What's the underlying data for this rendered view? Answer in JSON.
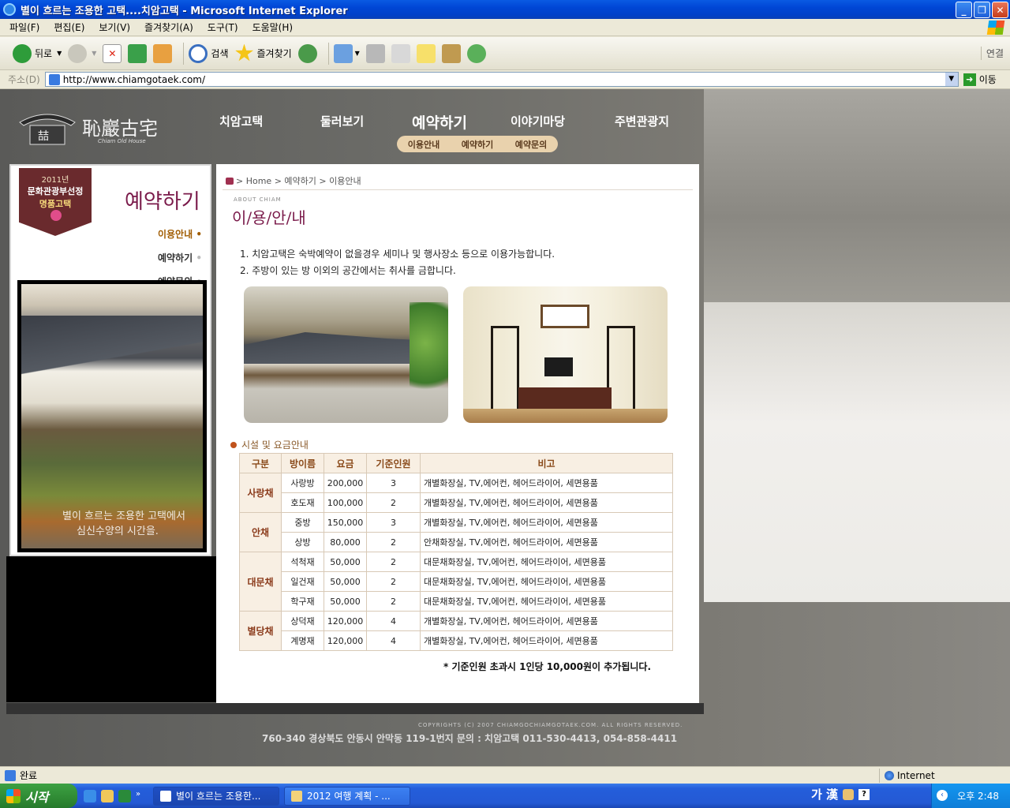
{
  "window": {
    "title": "별이 흐르는 조용한 고택....치암고택 - Microsoft Internet Explorer"
  },
  "menu": [
    "파일(F)",
    "편집(E)",
    "보기(V)",
    "즐겨찾기(A)",
    "도구(T)",
    "도움말(H)"
  ],
  "toolbar": {
    "back": "뒤로",
    "search": "검색",
    "favorites": "즐겨찾기",
    "links": "연결"
  },
  "address": {
    "label": "주소(D)",
    "url": "http://www.chiamgotaek.com/",
    "go": "이동"
  },
  "site": {
    "logo_text": "恥巖古宅",
    "logo_sub": "Chiam Old House",
    "nav": [
      "치암고택",
      "둘러보기",
      "예약하기",
      "이야기마당",
      "주변관광지"
    ],
    "subnav": [
      "이용안내",
      "예약하기",
      "예약문의"
    ],
    "badge": {
      "year": "2011년",
      "line1": "문화관광부선정",
      "line2": "명품고택"
    },
    "left_title": "예약하기",
    "left_menu": [
      "이용안내",
      "예약하기",
      "예약문의"
    ],
    "photo_caption": [
      "별이 흐르는 조용한 고택에서",
      "심신수양의 시간을."
    ],
    "breadcrumb": {
      "home": "Home",
      "section": "예약하기",
      "page": "이용안내"
    },
    "about": "ABOUT CHIAM",
    "page_title": "이/용/안/내",
    "notes": [
      "1. 치암고택은 숙박예약이 없을경우 세미나 및 행사장소 등으로 이용가능합니다.",
      "2. 주방이 있는 방 이외의 공간에서는 취사를 금합니다."
    ],
    "section_title": "시설 및 요금안내",
    "table": {
      "headers": [
        "구분",
        "방이름",
        "요금",
        "기준인원",
        "비고"
      ],
      "groups": [
        {
          "name": "사랑채",
          "rows": [
            {
              "room": "사랑방",
              "fee": "200,000",
              "people": "3",
              "note": "개별화장실, TV,에어컨, 헤어드라이어, 세면용품"
            },
            {
              "room": "호도재",
              "fee": "100,000",
              "people": "2",
              "note": "개별화장실, TV,에어컨, 헤어드라이어, 세면용품"
            }
          ]
        },
        {
          "name": "안채",
          "rows": [
            {
              "room": "중방",
              "fee": "150,000",
              "people": "3",
              "note": "개별화장실, TV,에어컨, 헤어드라이어, 세면용품"
            },
            {
              "room": "상방",
              "fee": "80,000",
              "people": "2",
              "note": "안채화장실, TV,에어컨, 헤어드라이어, 세면용품"
            }
          ]
        },
        {
          "name": "대문채",
          "rows": [
            {
              "room": "석척재",
              "fee": "50,000",
              "people": "2",
              "note": "대문채화장실, TV,에어컨, 헤어드라이어, 세면용품"
            },
            {
              "room": "일건재",
              "fee": "50,000",
              "people": "2",
              "note": "대문채화장실, TV,에어컨, 헤어드라이어, 세면용품"
            },
            {
              "room": "학구재",
              "fee": "50,000",
              "people": "2",
              "note": "대문채화장실, TV,에어컨, 헤어드라이어, 세면용품"
            }
          ]
        },
        {
          "name": "별당채",
          "rows": [
            {
              "room": "상덕재",
              "fee": "120,000",
              "people": "4",
              "note": "개별화장실, TV,에어컨, 헤어드라이어, 세면용품"
            },
            {
              "room": "계명재",
              "fee": "120,000",
              "people": "4",
              "note": "개별화장실, TV,에어컨, 헤어드라이어, 세면용품"
            }
          ]
        }
      ]
    },
    "surcharge": "* 기준인원 초과시 1인당 10,000원이 추가됩니다.",
    "copyright": "COPYRIGHTS (C) 2007 CHIAMGOCHIAMGOTAEK.COM. ALL RIGHTS RESERVED.",
    "address": "760-340 경상북도 안동시 안막동 119-1번지 문의 : 치암고택 011-530-4413, 054-858-4411"
  },
  "status": {
    "text": "완료",
    "zone": "Internet"
  },
  "taskbar": {
    "start": "시작",
    "tasks": [
      "별이 흐르는 조용한...",
      "2012 여행 계획 - ..."
    ],
    "ime": "가 漢",
    "clock": "오후 2:48"
  }
}
